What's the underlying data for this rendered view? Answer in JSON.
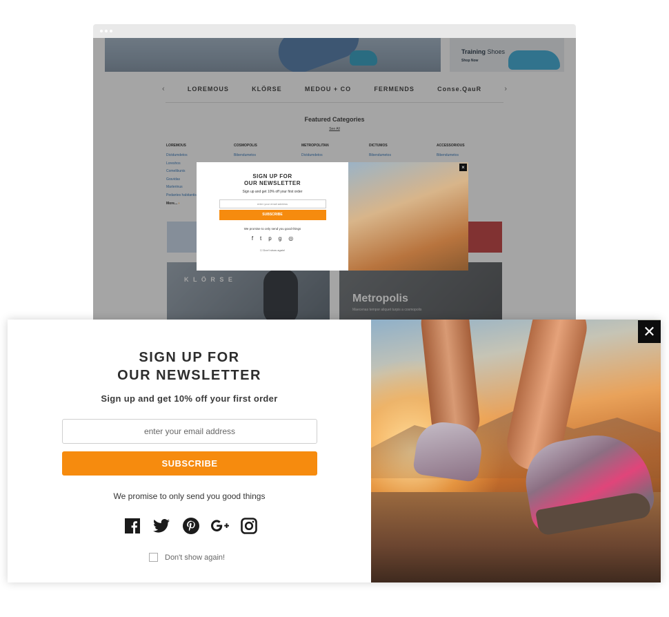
{
  "background_site": {
    "hero_side": {
      "title_bold": "Training",
      "title_rest": " Shoes",
      "cta": "Shop Now"
    },
    "brands": [
      "LOREMOUS",
      "KLÖRSE",
      "MEDOU + CO",
      "FERMENDS",
      "Conse.QauR"
    ],
    "featured": {
      "title": "Featured Categories",
      "see_all": "See All"
    },
    "categories": [
      {
        "heading": "LOREMOUS",
        "items": [
          "Dictdumdetos",
          "Loreshos",
          "Comelibunis",
          "Gravidas",
          "Marterinus",
          "Pedantes habitantis"
        ],
        "more": "More..."
      },
      {
        "heading": "COSMOPOLIS",
        "items": [
          "Bibendumetos"
        ]
      },
      {
        "heading": "METROPOLITAN",
        "items": [
          "Dictdumdetos"
        ]
      },
      {
        "heading": "DICTUMOS",
        "items": [
          "Bibendumetos"
        ]
      },
      {
        "heading": "ACCESSORIOUS",
        "items": [
          "Bibendumetos"
        ]
      }
    ],
    "tiles": {
      "left_logo": "K L Ö R S E",
      "right_title": "Metropolis",
      "right_sub": "Maecenas tempor aliquet turpis a cosmopolis"
    }
  },
  "mini_popup": {
    "title_line1": "SIGN UP FOR",
    "title_line2": "OUR NEWSLETTER",
    "subtitle": "Sign up and get 10% off your first order",
    "placeholder": "enter your email address",
    "button": "SUBSCRIBE",
    "promise": "We promise to only send you good things",
    "checkbox": "Don't show again!"
  },
  "popup": {
    "title_line1": "SIGN UP FOR",
    "title_line2": "OUR NEWSLETTER",
    "subtitle": "Sign up and get 10% off your first order",
    "email_placeholder": "enter your email address",
    "subscribe_label": "SUBSCRIBE",
    "promise": "We promise to only send you good things",
    "checkbox_label": "Don't show again!",
    "social_icons": [
      "facebook-icon",
      "twitter-icon",
      "pinterest-icon",
      "google-plus-icon",
      "instagram-icon"
    ]
  },
  "colors": {
    "accent": "#f68b0e",
    "close_bg": "#0d0d0d",
    "text_dark": "#2d2d2d"
  }
}
